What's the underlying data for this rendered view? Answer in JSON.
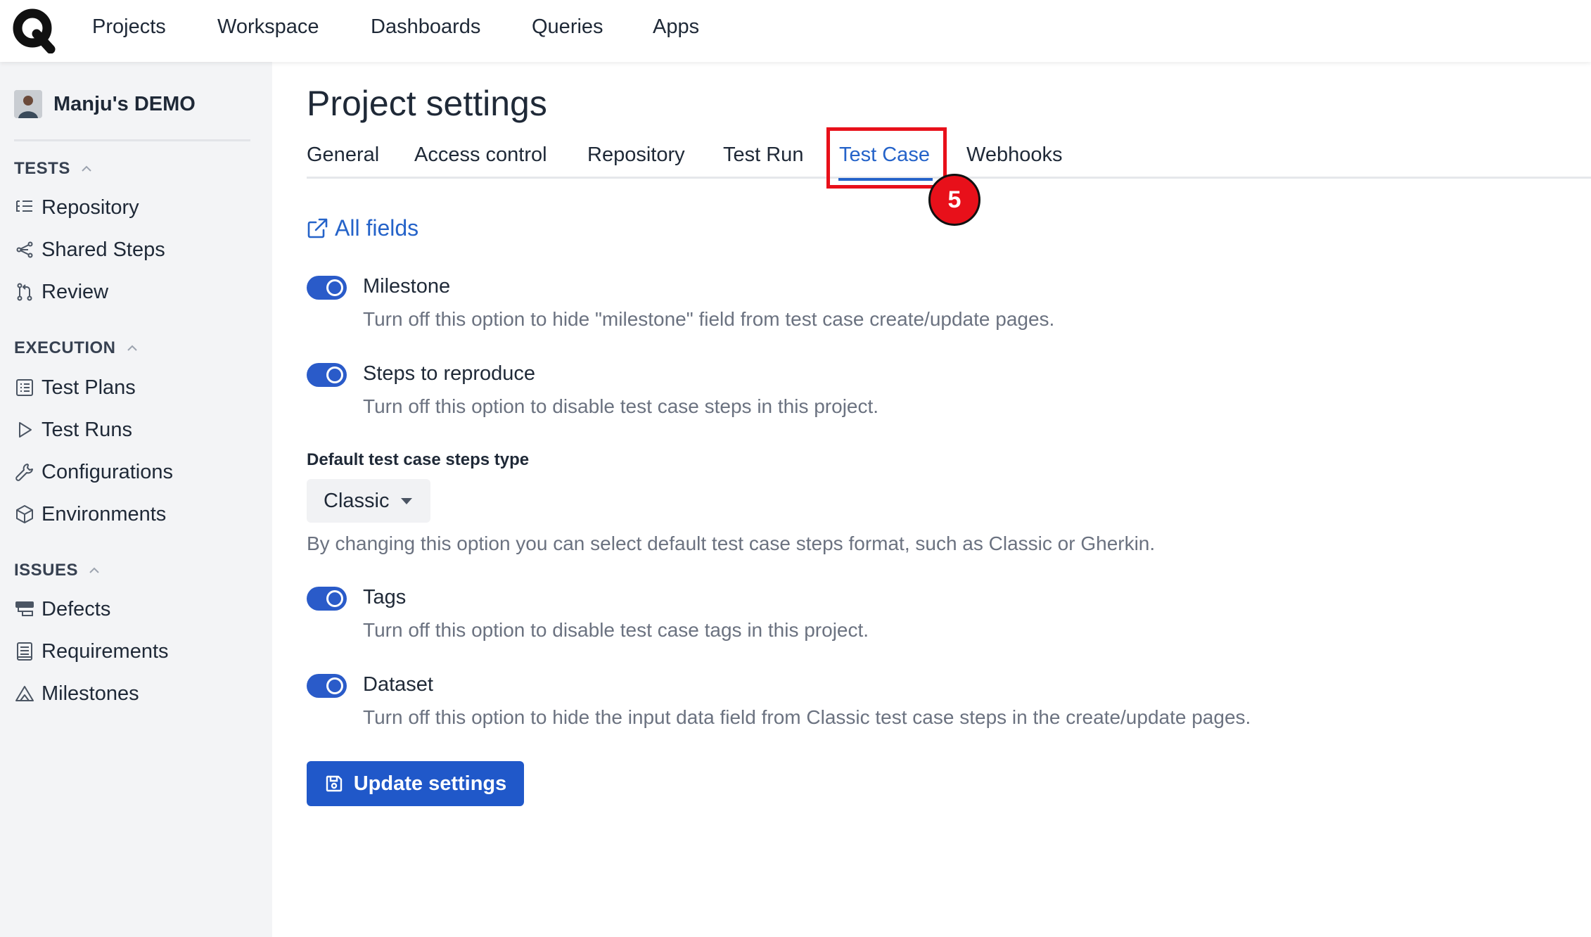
{
  "topnav": {
    "items": [
      {
        "label": "Projects"
      },
      {
        "label": "Workspace"
      },
      {
        "label": "Dashboards"
      },
      {
        "label": "Queries"
      },
      {
        "label": "Apps"
      }
    ]
  },
  "sidebar": {
    "project_name": "Manju's DEMO",
    "sections": [
      {
        "heading": "TESTS",
        "items": [
          {
            "label": "Repository",
            "icon": "repository-icon"
          },
          {
            "label": "Shared Steps",
            "icon": "shared-steps-icon"
          },
          {
            "label": "Review",
            "icon": "review-icon"
          }
        ]
      },
      {
        "heading": "EXECUTION",
        "items": [
          {
            "label": "Test Plans",
            "icon": "test-plans-icon"
          },
          {
            "label": "Test Runs",
            "icon": "play-icon"
          },
          {
            "label": "Configurations",
            "icon": "wrench-icon"
          },
          {
            "label": "Environments",
            "icon": "cube-icon"
          }
        ]
      },
      {
        "heading": "ISSUES",
        "items": [
          {
            "label": "Defects",
            "icon": "defects-icon"
          },
          {
            "label": "Requirements",
            "icon": "requirements-icon"
          },
          {
            "label": "Milestones",
            "icon": "milestone-icon"
          }
        ]
      }
    ]
  },
  "main": {
    "title": "Project settings",
    "tabs": [
      {
        "label": "General"
      },
      {
        "label": "Access control"
      },
      {
        "label": "Repository"
      },
      {
        "label": "Test Run"
      },
      {
        "label": "Test Case",
        "active": true
      },
      {
        "label": "Webhooks"
      }
    ],
    "step_badge": "5",
    "all_fields_link": "All fields",
    "options": [
      {
        "label": "Milestone",
        "description": "Turn off this option to hide \"milestone\" field from test case create/update pages.",
        "enabled": true
      },
      {
        "label": "Steps to reproduce",
        "description": "Turn off this option to disable test case steps in this project.",
        "enabled": true
      },
      {
        "label": "Tags",
        "description": "Turn off this option to disable test case tags in this project.",
        "enabled": true
      },
      {
        "label": "Dataset",
        "description": "Turn off this option to hide the input data field from Classic test case steps in the create/update pages.",
        "enabled": true
      }
    ],
    "steps_type": {
      "label": "Default test case steps type",
      "value": "Classic",
      "help": "By changing this option you can select default test case steps format, such as Classic or Gherkin."
    },
    "update_button": "Update settings"
  },
  "colors": {
    "accent": "#2563c9",
    "highlight": "#e8101a",
    "sidebar_bg": "#f3f4f6"
  }
}
